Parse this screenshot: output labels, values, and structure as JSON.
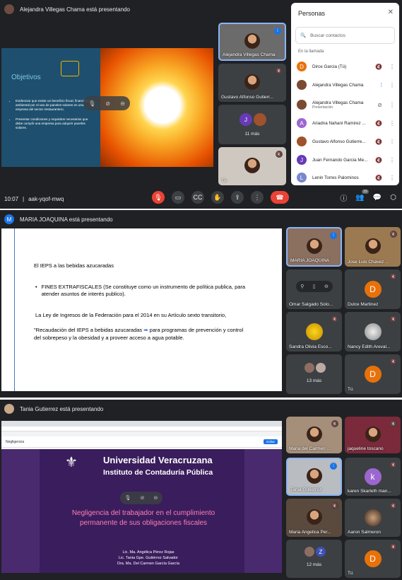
{
  "panel1": {
    "presenter_banner": "Alejandra Villegas Chama está presentando",
    "meeting_time": "10:07",
    "meeting_code": "aak-yqof-mwq",
    "slide": {
      "title": "Objetivos",
      "bullets": [
        "Evidenciar que existe un beneficio fiscal, financiero y ambiental por el uso de paneles solares en una empresa del sector restaurantero.",
        "Presentar condiciones y requisitos necesarios que debe cumplir una empresa para adquirir paneles solares."
      ]
    },
    "tiles": [
      {
        "name": "Alejandra Villegas Chama"
      },
      {
        "name": "Gustavo Alfonso Gutierr..."
      },
      {
        "name": "11 más",
        "initial": "J"
      },
      {
        "name": "Tú"
      }
    ],
    "participants_count": "15",
    "people_panel": {
      "title": "Personas",
      "search_placeholder": "Buscar contactos",
      "section": "En la llamada",
      "list": [
        {
          "name": "Dirce Garcia (Tú)",
          "initial": "D",
          "color": "#e8710a"
        },
        {
          "name": "Alejandra Villegas Chama",
          "initial": "",
          "color": "#7b4a32"
        },
        {
          "name": "Alejandra Villegas Chama",
          "sub": "Presentación",
          "initial": "",
          "color": "#7b4a32"
        },
        {
          "name": "Ariadna Nahani Ramirez ...",
          "initial": "A",
          "color": "#9c66d0"
        },
        {
          "name": "Gustavo Alfonso Gutierre...",
          "initial": "",
          "color": "#a0522d"
        },
        {
          "name": "Juan Fernando Garcia Me...",
          "initial": "J",
          "color": "#673ab7"
        },
        {
          "name": "Lenin Torres Palominos",
          "initial": "L",
          "color": "#7986cb"
        }
      ]
    }
  },
  "panel2": {
    "presenter_banner": "MARIA JOAQUINA está presentando",
    "banner_initial": "M",
    "slide": {
      "heading": "El IEPS a las bebidas azucaradas",
      "bullet": "FINES EXTRAFISCALES (Se constituye como un instrumento de política publica, para atender asuntos de interés publico).",
      "p1": "La Ley de Ingresos de la Federación para el 2014 en su Artículo sexto transitorio,",
      "p2_a": "\"Recaudación del IEPS a bebidas azucaradas",
      "p2_b": "para programas de prevención y control del sobrepeso y la obesidad y a proveer acceso a agua potable."
    },
    "tiles": [
      {
        "name": "MARIA JOAQUINA"
      },
      {
        "name": "Jose Luis Chavez ..."
      },
      {
        "name": "Omar Salgado Solo..."
      },
      {
        "name": "Dulce Martinez",
        "initial": "D"
      },
      {
        "name": "Sandra Olivia Esco..."
      },
      {
        "name": "Nancy Edith Areval..."
      },
      {
        "name": "13 más"
      },
      {
        "name": "Tú",
        "initial": "D"
      }
    ]
  },
  "panel3": {
    "presenter_banner": "Tania Gutierrez está presentando",
    "tab_title": "Negligencia",
    "edit_label": "Editar",
    "slide": {
      "university": "Universidad Veracruzana",
      "institute": "Instituto de Contaduría Pública",
      "title": "Negligencia del trabajador en el cumplimiento permanente de sus obligaciones fiscales",
      "authors": [
        "Lic. Ma. Angélica Pérez Rojas",
        "Lic. Tania Gpe. Gutiérrez Salvador",
        "Dra. Ma. Del Carmen García García"
      ]
    },
    "tiles": [
      {
        "name": "Maria del Carmen ..."
      },
      {
        "name": "jaqueline toscano"
      },
      {
        "name": "Tania Gutierrez"
      },
      {
        "name": "karen Skarleth man...",
        "initial": "k"
      },
      {
        "name": "Maria Angelica Per..."
      },
      {
        "name": "Aaron Salmeron"
      },
      {
        "name": "12 más",
        "initial": "Z"
      },
      {
        "name": "Tú",
        "initial": "D"
      }
    ]
  },
  "colors": {
    "meet_dark": "#202124",
    "tile": "#3c4043",
    "end_call": "#ea4335",
    "speaking": "#1a73e8",
    "slide_purple": "#3a1d5c",
    "objetivos_blue": "#1e4f6e"
  }
}
